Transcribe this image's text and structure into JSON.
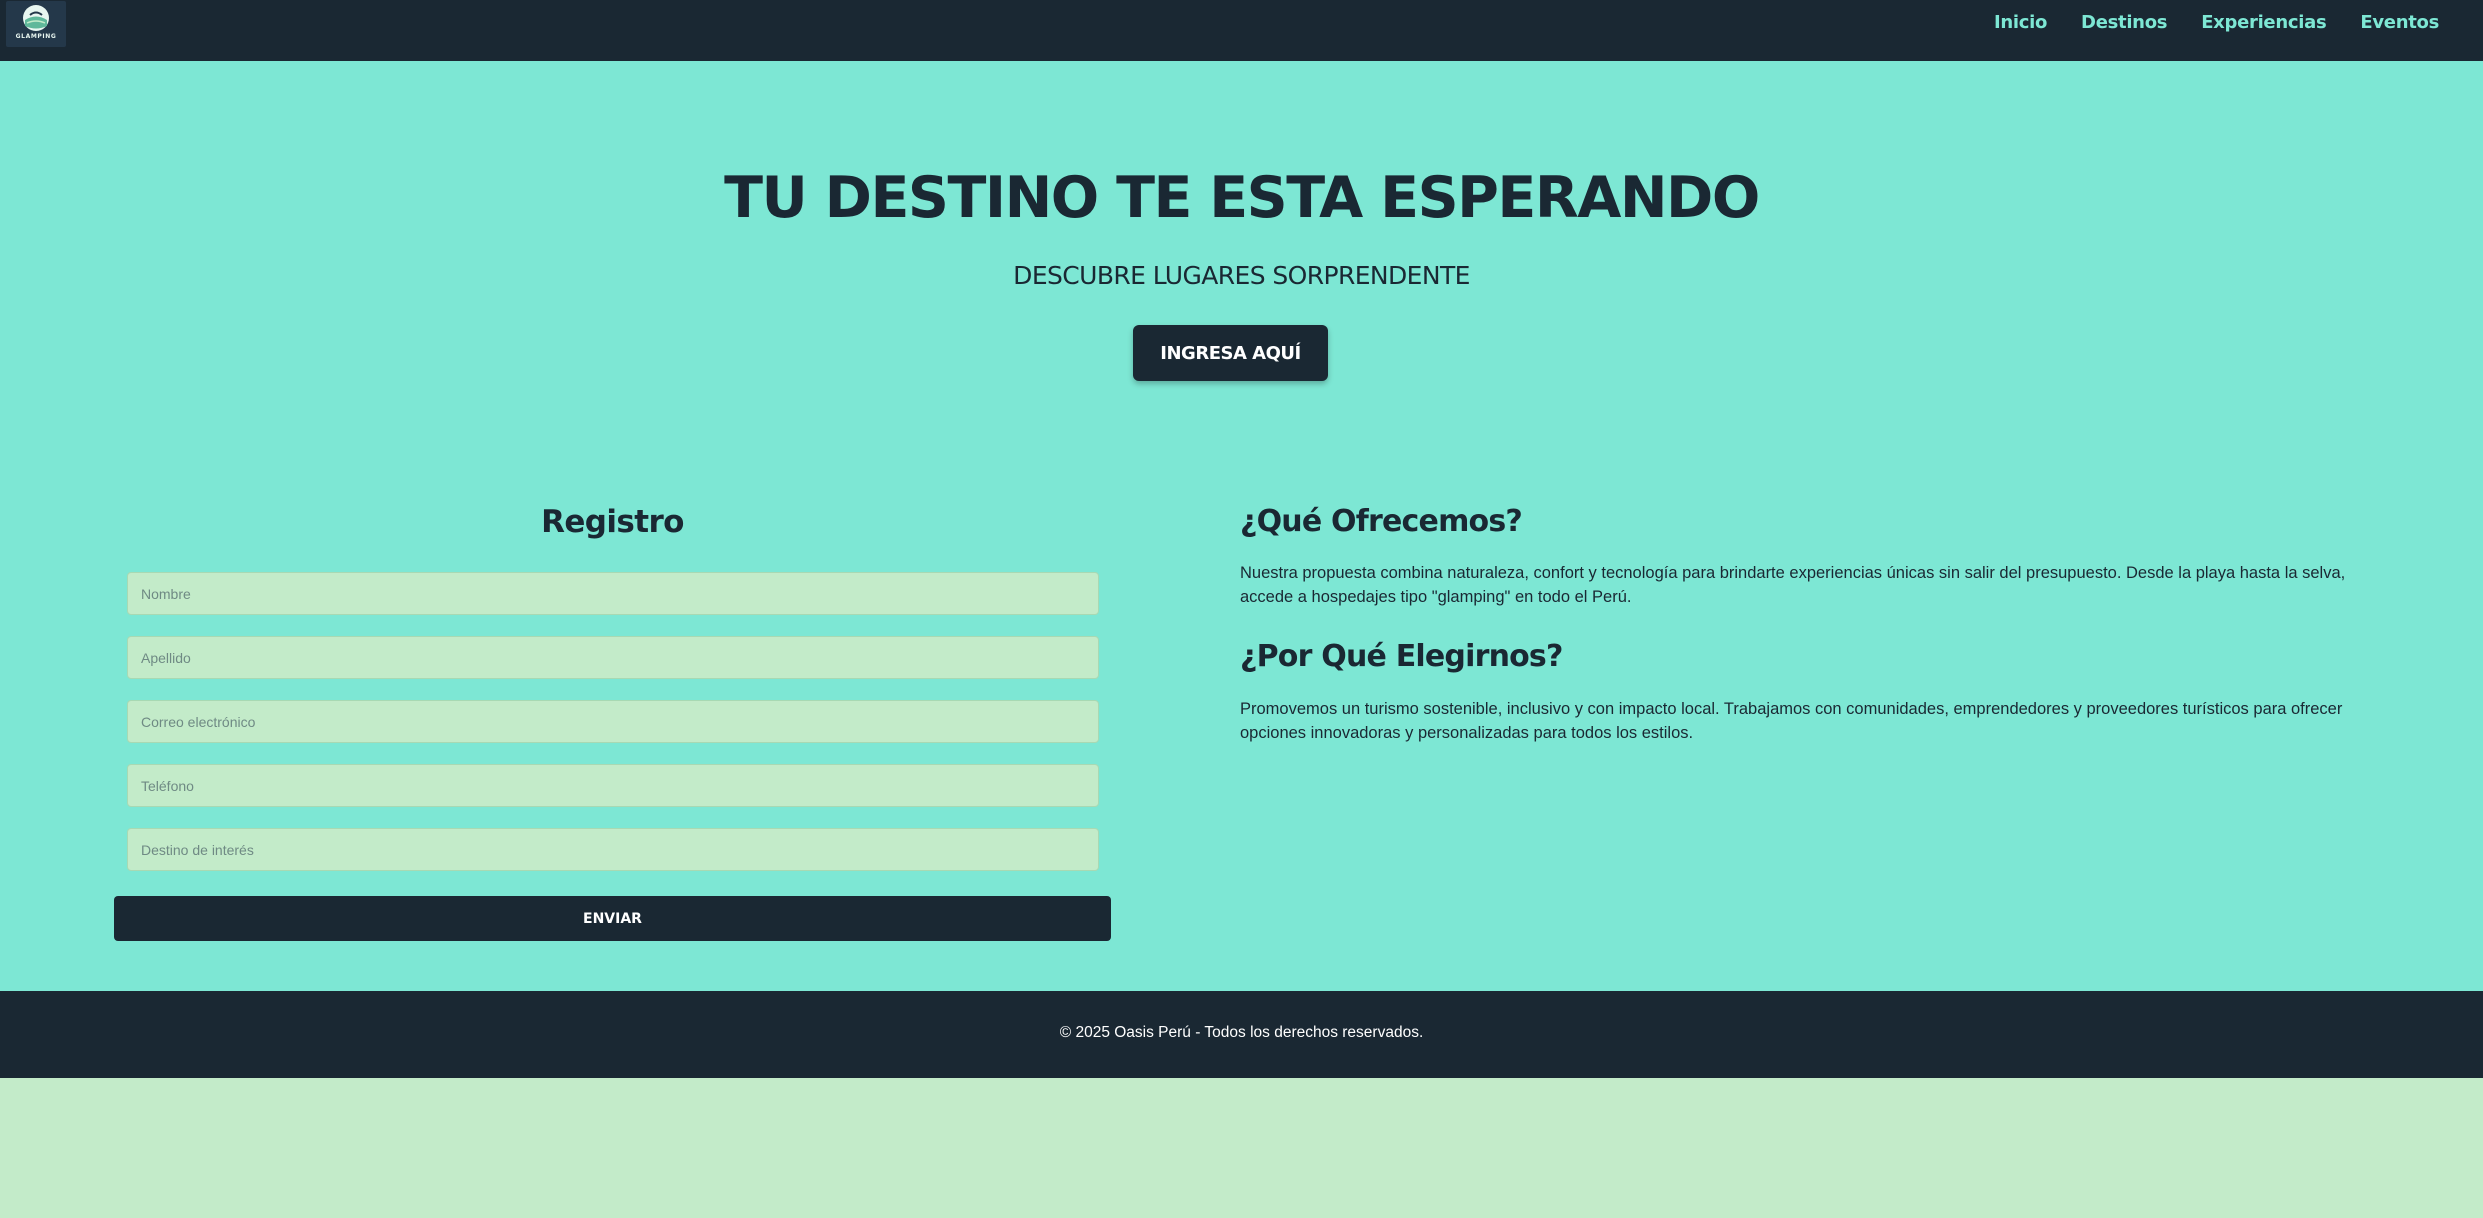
{
  "colors": {
    "dark": "#1a2833",
    "accent": "#7de7d4",
    "light": "#c3ebc9"
  },
  "nav": {
    "logo_text": "GLAMPING",
    "links": [
      "Inicio",
      "Destinos",
      "Experiencias",
      "Eventos"
    ]
  },
  "hero": {
    "title": "TU DESTINO TE ESTA ESPERANDO",
    "subtitle": "DESCUBRE LUGARES SORPRENDENTE",
    "button_label": "INGRESA AQUÍ"
  },
  "form": {
    "title": "Registro",
    "fields": [
      {
        "placeholder": "Nombre",
        "value": ""
      },
      {
        "placeholder": "Apellido",
        "value": ""
      },
      {
        "placeholder": "Correo electrónico",
        "value": ""
      },
      {
        "placeholder": "Teléfono",
        "value": ""
      },
      {
        "placeholder": "Destino de interés",
        "value": ""
      }
    ],
    "submit_label": "ENVIAR"
  },
  "info": {
    "offer_title": "¿Qué Ofrecemos?",
    "offer_text": "Nuestra propuesta combina naturaleza, confort y tecnología para brindarte experiencias únicas sin salir del presupuesto. Desde la playa hasta la selva, accede a hospedajes tipo \"glamping\" en todo el Perú.",
    "why_title": "¿Por Qué Elegirnos?",
    "why_text": "Promovemos un turismo sostenible, inclusivo y con impacto local. Trabajamos con comunidades, emprendedores y proveedores turísticos para ofrecer opciones innovadoras y personalizadas para todos los estilos."
  },
  "footer": {
    "text": "© 2025 Oasis Perú - Todos los derechos reservados."
  }
}
